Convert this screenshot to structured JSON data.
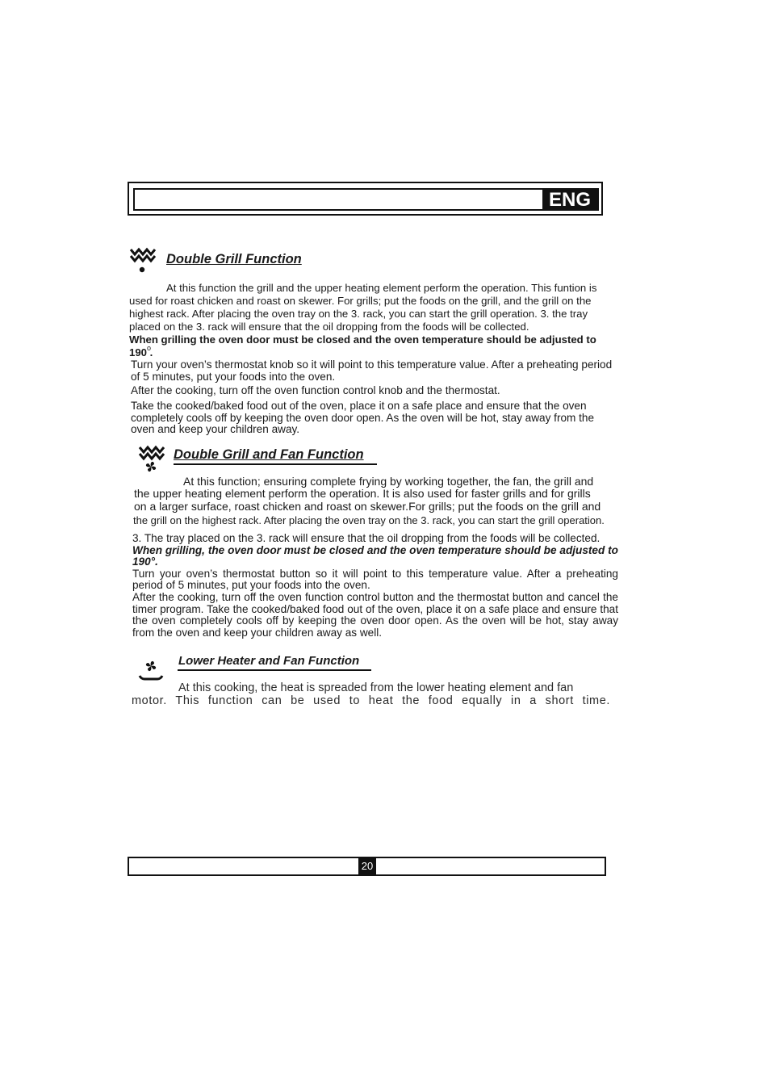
{
  "header": {
    "language_badge": "ENG"
  },
  "sections": [
    {
      "icon": "double-grill-icon",
      "title": "Double Grill Function",
      "intro": "At this function the grill and the upper heating element perform the operation. This funtion is used for roast chicken and roast on skewer. For grills; put the foods on the grill, and the grill on the highest  rack. After placing the oven tray on the 3. rack, you can start the grill operation. 3. the tray placed on the 3. rack will ensure that the oil dropping from the foods will be collected.",
      "warning": "When grilling the oven door must be closed and the oven temperature should be adjusted to 190 .",
      "warning_degree": "o",
      "preheat": "Turn your oven’s thermostat  knob  so it will point to this temperature value. After a preheating period of 5 minutes, put your foods into the oven.",
      "after_cooking": "After the cooking, turn off the oven function control  knob  and the thermostat.",
      "cooling": "Take the cooked/baked food out of the oven, place it on a safe place and ensure that the oven completely cools off by keeping the oven door open. As the oven will be hot, stay away from the oven and keep your children away."
    },
    {
      "icon": "double-grill-fan-icon",
      "title": "Double Grill and Fan Function",
      "intro_lines": [
        "At this function; ensuring complete frying by working together, the fan, the grill and",
        "the upper heating element perform the operation. It is also used for faster grills and for grills",
        "on a larger surface, roast chicken and roast on skewer.For grills; put the foods on the grill  and",
        "the grill on the highest rack. After placing the oven tray on the 3. rack, you can start the grill operation."
      ],
      "tray_note": "3. The tray placed on the 3. rack will ensure that the oil dropping from the foods will be collected.",
      "warning": "When grilling, the oven door must be closed and the oven temperature should be adjusted to 190°.",
      "preheat": "Turn your oven’s thermostat button so it will point to this temperature value. After a preheating period of 5 minutes, put your foods into the oven.",
      "after_cooking": "After the cooking, turn off the oven function control button and the thermostat button and cancel the timer program. Take the cooked/baked food out of the oven, place it on a safe place and ensure that the oven completely cools off by keeping the oven door open. As the oven will be hot, stay away from the oven and keep your children away as well."
    },
    {
      "icon": "lower-heater-fan-icon",
      "title": "Lower Heater and Fan Function",
      "body_line1": "At this cooking, the heat is spreaded from the lower heating element and fan",
      "body_line2": "motor. This function can be used to heat the food equally in a short time."
    }
  ],
  "footer": {
    "page_number": "20"
  }
}
